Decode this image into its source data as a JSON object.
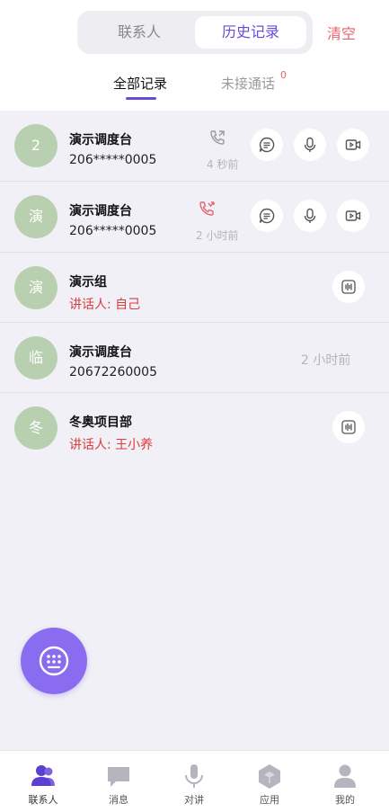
{
  "header": {
    "segments": [
      "联系人",
      "历史记录"
    ],
    "clear_label": "清空",
    "subtabs": [
      "全部记录",
      "未接通话"
    ],
    "missed_badge": "0"
  },
  "records": [
    {
      "avatar": "2",
      "name": "演示调度台",
      "sub": "206*****0005",
      "time": "4 秒前",
      "call_type": "outgoing",
      "actions": [
        "message",
        "voice",
        "video"
      ]
    },
    {
      "avatar": "演",
      "name": "演示调度台",
      "sub": "206*****0005",
      "time": "2 小时前",
      "call_type": "missed",
      "actions": [
        "message",
        "voice",
        "video"
      ]
    },
    {
      "avatar": "演",
      "name": "演示组",
      "sub": "讲话人: 自己",
      "time": "",
      "call_type": "",
      "actions": [
        "ptt"
      ]
    },
    {
      "avatar": "临",
      "name": "演示调度台",
      "sub": "20672260005",
      "time": "2 小时前",
      "call_type": "",
      "actions": []
    },
    {
      "avatar": "冬",
      "name": "冬奥项目部",
      "sub": "讲话人: 王小养",
      "time": "",
      "call_type": "",
      "actions": [
        "ptt"
      ]
    }
  ],
  "fab": {
    "icon": "dialpad-icon"
  },
  "tabbar": [
    {
      "label": "联系人",
      "icon": "contacts-icon",
      "active": true
    },
    {
      "label": "消息",
      "icon": "message-icon",
      "active": false
    },
    {
      "label": "对讲",
      "icon": "microphone-icon",
      "active": false
    },
    {
      "label": "应用",
      "icon": "app-cube-icon",
      "active": false
    },
    {
      "label": "我的",
      "icon": "profile-icon",
      "active": false
    }
  ],
  "colors": {
    "accent": "#6a4bd8",
    "danger": "#e3666d",
    "avatar": "#b9d0b0",
    "fab": "#8a6cf0"
  }
}
